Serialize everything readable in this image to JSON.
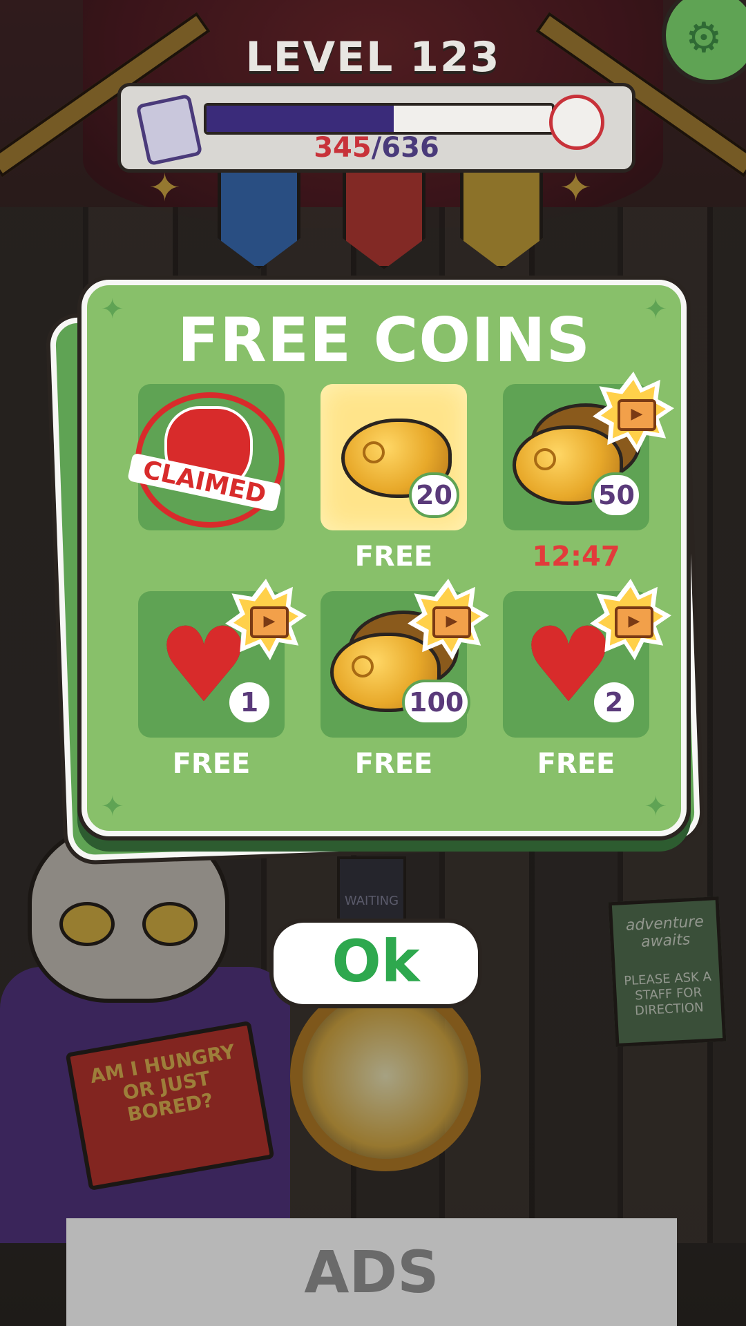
{
  "header": {
    "level_label": "LEVEL 123",
    "progress_current": "345",
    "progress_separator": "/",
    "progress_total": "636",
    "progress_fraction": 0.542
  },
  "settings": {
    "icon": "gear-icon",
    "glyph": "⚙"
  },
  "modal": {
    "title": "FREE COINS",
    "rewards": [
      {
        "type": "claimed-stamp",
        "stamp_text": "CLAIMED",
        "caption": ""
      },
      {
        "type": "coin",
        "amount": "20",
        "caption": "FREE",
        "highlighted": true,
        "ad_required": false
      },
      {
        "type": "coin-stack",
        "amount": "50",
        "caption": "12:47",
        "caption_style": "timer",
        "ad_required": true
      },
      {
        "type": "heart",
        "amount": "1",
        "caption": "FREE",
        "ad_required": true
      },
      {
        "type": "coin-stack",
        "amount": "100",
        "caption": "FREE",
        "ad_required": true
      },
      {
        "type": "heart",
        "amount": "2",
        "caption": "FREE",
        "ad_required": true
      }
    ],
    "ok_label": "Ok"
  },
  "background": {
    "book_title": "AM I HUNGRY OR JUST BORED?",
    "sign_title": "adventure awaits",
    "sign_text": "PLEASE ASK A STAFF FOR DIRECTION",
    "door_text": "WAITING"
  },
  "ads_label": "ADS",
  "colors": {
    "modal_green": "#88c06a",
    "tile_green": "#5fa354",
    "highlight_yellow": "#ffe48a",
    "timer_red": "#e23b3b",
    "ok_green": "#2ea84e",
    "progress_purple": "#3a2b7a"
  }
}
